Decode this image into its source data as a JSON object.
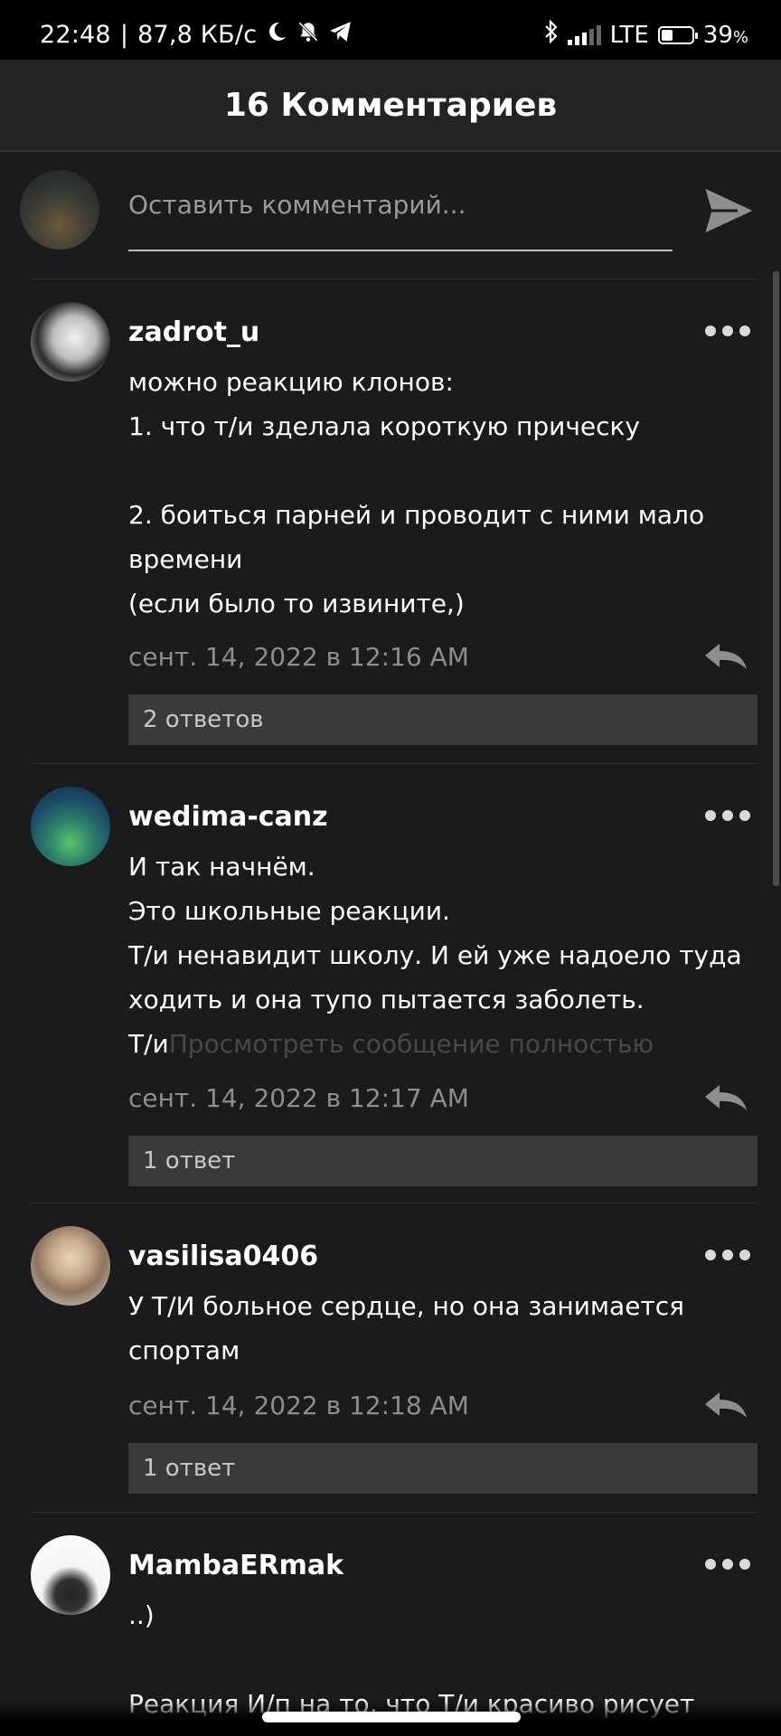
{
  "status_bar": {
    "time": "22:48",
    "separator": "|",
    "speed": "87,8 КБ/с",
    "network": "LTE",
    "battery_percent": "39",
    "battery_unit": "%",
    "battery_level": 0.39
  },
  "header": {
    "title": "16 Комментариев"
  },
  "compose": {
    "placeholder": "Оставить комментарий..."
  },
  "comments": [
    {
      "username": "zadrot_u",
      "lines": [
        "можно реакцию клонов:",
        "1. что т/и зделала короткую прическу",
        "",
        "2. боиться парней и проводит с ними мало",
        "времени",
        "(если было то извините,)"
      ],
      "date": "сент. 14, 2022 в 12:16 AM",
      "replies": "2 ответов"
    },
    {
      "username": "wedima-canz",
      "lines": [
        "И так начнём.",
        "Это школьные реакции.",
        "Т/и ненавидит школу. И ей уже надоело туда",
        "ходить и она тупо пытается заболеть."
      ],
      "last_line_start": "Т/и",
      "see_more": "Просмотреть сообщение полностью",
      "date": "сент. 14, 2022 в 12:17 AM",
      "replies": "1 ответ"
    },
    {
      "username": "vasilisa0406",
      "lines": [
        "У Т/И больное сердце, но она занимается",
        "спортам"
      ],
      "date": "сент. 14, 2022 в 12:18 AM",
      "replies": "1 ответ"
    },
    {
      "username": "MambaERmak",
      "lines": [
        "..)",
        "",
        "Реакция И/п на то, что Т/и красиво рисует"
      ]
    }
  ],
  "colors": {
    "background": "#1b1a1c",
    "header": "#232224",
    "replies_bar": "#3a393c",
    "date": "#8e8d90",
    "see_more": "#48474a"
  }
}
